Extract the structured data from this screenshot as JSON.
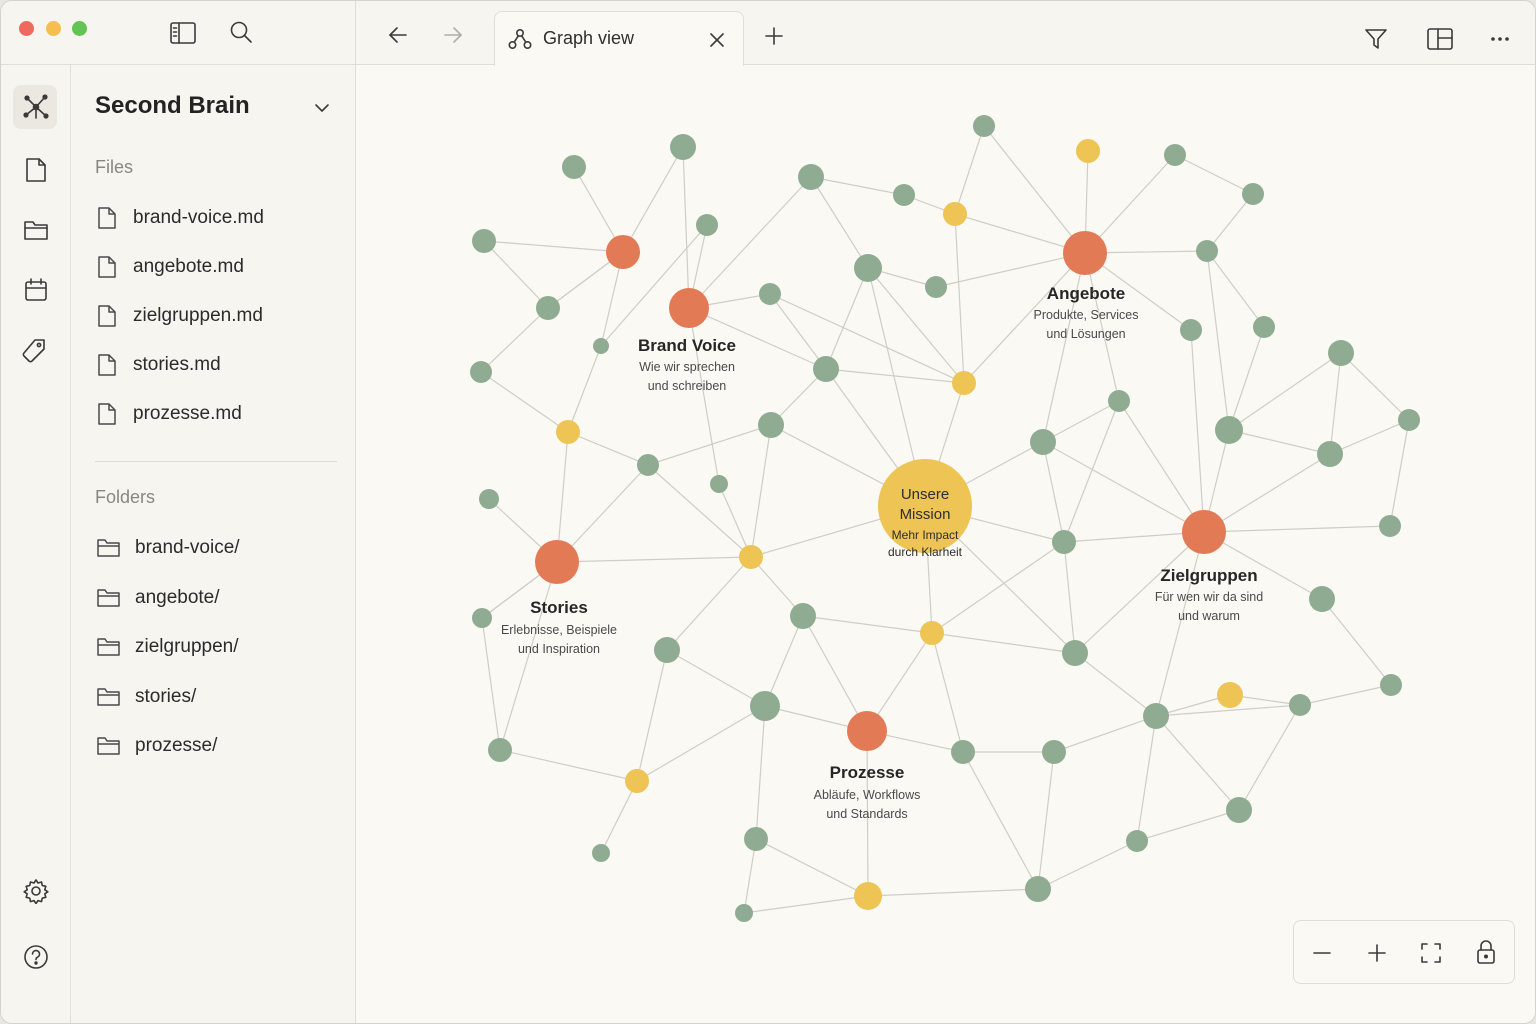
{
  "toolbar": {
    "tab_title": "Graph view"
  },
  "sidebar": {
    "vault_name": "Second Brain",
    "files_label": "Files",
    "files": [
      "brand-voice.md",
      "angebote.md",
      "zielgruppen.md",
      "stories.md",
      "prozesse.md"
    ],
    "folders_label": "Folders",
    "folders": [
      "brand-voice/",
      "angebote/",
      "zielgruppen/",
      "stories/",
      "prozesse/"
    ]
  },
  "colors": {
    "green": "#8fac92",
    "orange": "#e27a55",
    "yellow": "#eec454",
    "edge": "#cfcdc4"
  },
  "graph": {
    "center": {
      "title_1": "Unsere",
      "title_2": "Mission",
      "sub_1": "Mehr Impact",
      "sub_2": "durch Klarheit"
    },
    "hubs": [
      {
        "title": "Brand Voice",
        "sub_1": "Wie wir sprechen",
        "sub_2": "und schreiben"
      },
      {
        "title": "Angebote",
        "sub_1": "Produkte, Services",
        "sub_2": "und Lösungen"
      },
      {
        "title": "Stories",
        "sub_1": "Erlebnisse, Beispiele",
        "sub_2": "und Inspiration"
      },
      {
        "title": "Zielgruppen",
        "sub_1": "Für wen wir da sind",
        "sub_2": "und warum"
      },
      {
        "title": "Prozesse",
        "sub_1": "Abläufe, Workflows",
        "sub_2": "und Standards"
      }
    ]
  },
  "icons": {
    "ribbon": [
      "graph-icon",
      "file-icon",
      "folder-icon",
      "calendar-icon",
      "tag-icon",
      "settings-icon",
      "help-icon"
    ],
    "toolbar": [
      "sidebar-toggle-icon",
      "search-icon",
      "back-arrow-icon",
      "forward-arrow-icon",
      "close-icon",
      "plus-icon",
      "filter-icon",
      "layout-icon",
      "more-icon"
    ],
    "zoom": [
      "zoom-out-icon",
      "zoom-in-icon",
      "fit-screen-icon",
      "lock-icon"
    ]
  }
}
